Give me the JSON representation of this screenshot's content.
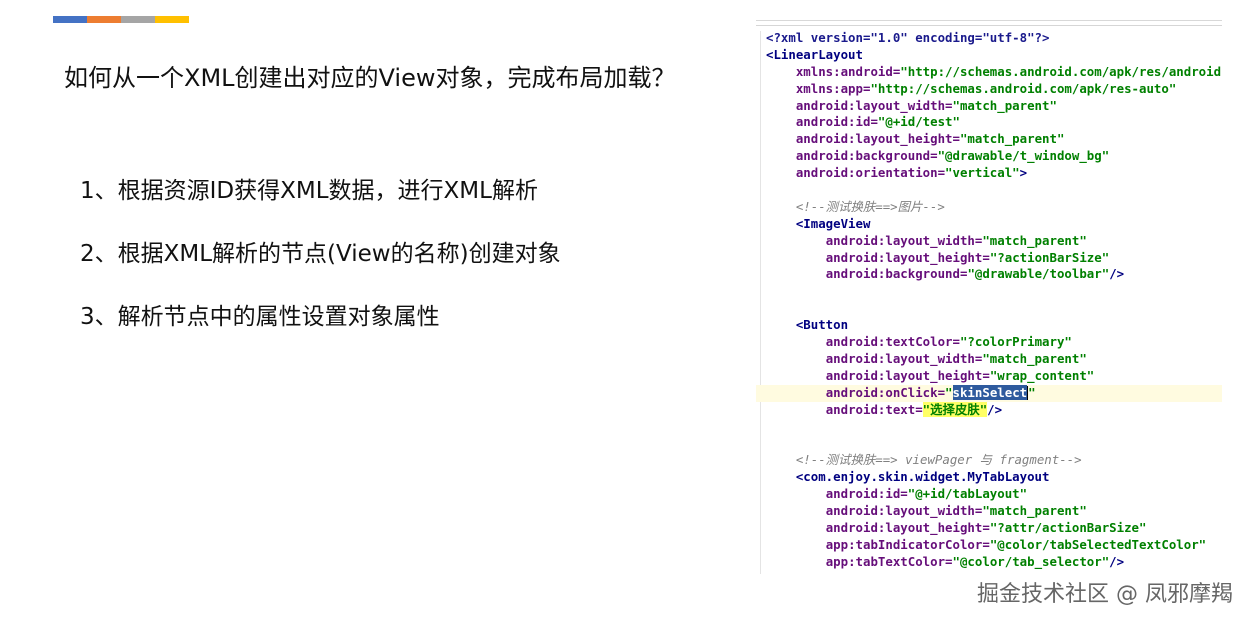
{
  "accent_colors": [
    "#4472c4",
    "#ed7d31",
    "#a5a5a5",
    "#ffc000"
  ],
  "slide": {
    "title": "如何从一个XML创建出对应的View对象，完成布局加载？",
    "points": [
      "1、根据资源ID获得XML数据，进行XML解析",
      "2、根据XML解析的节点(View的名称)创建对象",
      "3、解析节点中的属性设置对象属性"
    ]
  },
  "code": {
    "lines": [
      [
        {
          "t": "<?xml version=\"1.0\" encoding=\"utf-8\"?>",
          "c": "decl"
        }
      ],
      [
        {
          "t": "<LinearLayout",
          "c": "tag"
        }
      ],
      [
        {
          "t": "    ",
          "c": "text"
        },
        {
          "t": "xmlns:android=",
          "c": "attr"
        },
        {
          "t": "\"http://schemas.android.com/apk/res/android\"",
          "c": "str"
        }
      ],
      [
        {
          "t": "    ",
          "c": "text"
        },
        {
          "t": "xmlns:app=",
          "c": "attr"
        },
        {
          "t": "\"http://schemas.android.com/apk/res-auto\"",
          "c": "str"
        }
      ],
      [
        {
          "t": "    ",
          "c": "text"
        },
        {
          "t": "android:layout_width=",
          "c": "attr"
        },
        {
          "t": "\"match_parent\"",
          "c": "str"
        }
      ],
      [
        {
          "t": "    ",
          "c": "text"
        },
        {
          "t": "android:id=",
          "c": "attr"
        },
        {
          "t": "\"@+id/test\"",
          "c": "str"
        }
      ],
      [
        {
          "t": "    ",
          "c": "text"
        },
        {
          "t": "android:layout_height=",
          "c": "attr"
        },
        {
          "t": "\"match_parent\"",
          "c": "str"
        }
      ],
      [
        {
          "t": "    ",
          "c": "text"
        },
        {
          "t": "android:background=",
          "c": "attr"
        },
        {
          "t": "\"@drawable/t_window_bg\"",
          "c": "str"
        }
      ],
      [
        {
          "t": "    ",
          "c": "text"
        },
        {
          "t": "android:orientation=",
          "c": "attr"
        },
        {
          "t": "\"vertical\"",
          "c": "str"
        },
        {
          "t": ">",
          "c": "tag"
        }
      ],
      [],
      [
        {
          "t": "    ",
          "c": "text"
        },
        {
          "t": "<!--测试换肤==>图片-->",
          "c": "com"
        }
      ],
      [
        {
          "t": "    ",
          "c": "text"
        },
        {
          "t": "<ImageView",
          "c": "tag"
        }
      ],
      [
        {
          "t": "        ",
          "c": "text"
        },
        {
          "t": "android:layout_width=",
          "c": "attr"
        },
        {
          "t": "\"match_parent\"",
          "c": "str"
        }
      ],
      [
        {
          "t": "        ",
          "c": "text"
        },
        {
          "t": "android:layout_height=",
          "c": "attr"
        },
        {
          "t": "\"?actionBarSize\"",
          "c": "str"
        }
      ],
      [
        {
          "t": "        ",
          "c": "text"
        },
        {
          "t": "android:background=",
          "c": "attr"
        },
        {
          "t": "\"@drawable/toolbar\"",
          "c": "str"
        },
        {
          "t": "/>",
          "c": "tag"
        }
      ],
      [],
      [],
      [
        {
          "t": "    ",
          "c": "text"
        },
        {
          "t": "<Button",
          "c": "tag"
        }
      ],
      [
        {
          "t": "        ",
          "c": "text"
        },
        {
          "t": "android:textColor=",
          "c": "attr"
        },
        {
          "t": "\"?colorPrimary\"",
          "c": "str"
        }
      ],
      [
        {
          "t": "        ",
          "c": "text"
        },
        {
          "t": "android:layout_width=",
          "c": "attr"
        },
        {
          "t": "\"match_parent\"",
          "c": "str"
        }
      ],
      [
        {
          "t": "        ",
          "c": "text"
        },
        {
          "t": "android:layout_height=",
          "c": "attr"
        },
        {
          "t": "\"wrap_content\"",
          "c": "str"
        }
      ],
      [
        {
          "t": "        ",
          "c": "text"
        },
        {
          "t": "android:onClick=",
          "c": "attr"
        },
        {
          "t": "\"",
          "c": "str"
        },
        {
          "t": "skinSelect",
          "c": "sel"
        },
        {
          "t": "\"",
          "c": "str"
        }
      ],
      [
        {
          "t": "        ",
          "c": "text"
        },
        {
          "t": "android:text=",
          "c": "attr"
        },
        {
          "t": "\"选择皮肤\"",
          "c": "strhl"
        },
        {
          "t": "/>",
          "c": "tag"
        }
      ],
      [],
      [],
      [
        {
          "t": "    ",
          "c": "text"
        },
        {
          "t": "<!--测试换肤==> viewPager 与 fragment-->",
          "c": "com"
        }
      ],
      [
        {
          "t": "    ",
          "c": "text"
        },
        {
          "t": "<com.enjoy.skin.widget.MyTabLayout",
          "c": "tag"
        }
      ],
      [
        {
          "t": "        ",
          "c": "text"
        },
        {
          "t": "android:id=",
          "c": "attr"
        },
        {
          "t": "\"@+id/tabLayout\"",
          "c": "str"
        }
      ],
      [
        {
          "t": "        ",
          "c": "text"
        },
        {
          "t": "android:layout_width=",
          "c": "attr"
        },
        {
          "t": "\"match_parent\"",
          "c": "str"
        }
      ],
      [
        {
          "t": "        ",
          "c": "text"
        },
        {
          "t": "android:layout_height=",
          "c": "attr"
        },
        {
          "t": "\"?attr/actionBarSize\"",
          "c": "str"
        }
      ],
      [
        {
          "t": "        ",
          "c": "text"
        },
        {
          "t": "app:tabIndicatorColor=",
          "c": "attr"
        },
        {
          "t": "\"@color/tabSelectedTextColor\"",
          "c": "str"
        }
      ],
      [
        {
          "t": "        ",
          "c": "text"
        },
        {
          "t": "app:tabTextColor=",
          "c": "attr"
        },
        {
          "t": "\"@color/tab_selector\"",
          "c": "str"
        },
        {
          "t": "/>",
          "c": "tag"
        }
      ]
    ]
  },
  "watermark": "掘金技术社区 @ 凤邪摩羯"
}
